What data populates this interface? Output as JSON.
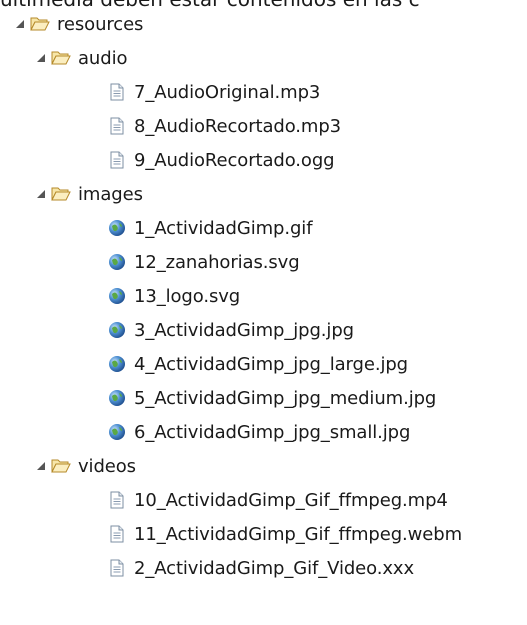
{
  "caption": "ultimedia deben estar contenidos en las c",
  "tree": {
    "root": {
      "label": "resources",
      "icon": "folder-open-icon",
      "expanded": true,
      "children": [
        {
          "label": "audio",
          "icon": "folder-open-icon",
          "expanded": true,
          "files": [
            {
              "label": "7_AudioOriginal.mp3",
              "icon": "text-file-icon"
            },
            {
              "label": "8_AudioRecortado.mp3",
              "icon": "text-file-icon"
            },
            {
              "label": "9_AudioRecortado.ogg",
              "icon": "text-file-icon"
            }
          ]
        },
        {
          "label": "images",
          "icon": "folder-open-icon",
          "expanded": true,
          "files": [
            {
              "label": "1_ActividadGimp.gif",
              "icon": "globe-file-icon"
            },
            {
              "label": "12_zanahorias.svg",
              "icon": "globe-file-icon"
            },
            {
              "label": "13_logo.svg",
              "icon": "globe-file-icon"
            },
            {
              "label": "3_ActividadGimp_jpg.jpg",
              "icon": "globe-file-icon"
            },
            {
              "label": "4_ActividadGimp_jpg_large.jpg",
              "icon": "globe-file-icon"
            },
            {
              "label": "5_ActividadGimp_jpg_medium.jpg",
              "icon": "globe-file-icon"
            },
            {
              "label": "6_ActividadGimp_jpg_small.jpg",
              "icon": "globe-file-icon"
            }
          ]
        },
        {
          "label": "videos",
          "icon": "folder-open-icon",
          "expanded": true,
          "files": [
            {
              "label": "10_ActividadGimp_Gif_ffmpeg.mp4",
              "icon": "text-file-icon"
            },
            {
              "label": "11_ActividadGimp_Gif_ffmpeg.webm",
              "icon": "text-file-icon"
            },
            {
              "label": "2_ActividadGimp_Gif_Video.xxx",
              "icon": "text-file-icon"
            }
          ]
        }
      ]
    }
  }
}
